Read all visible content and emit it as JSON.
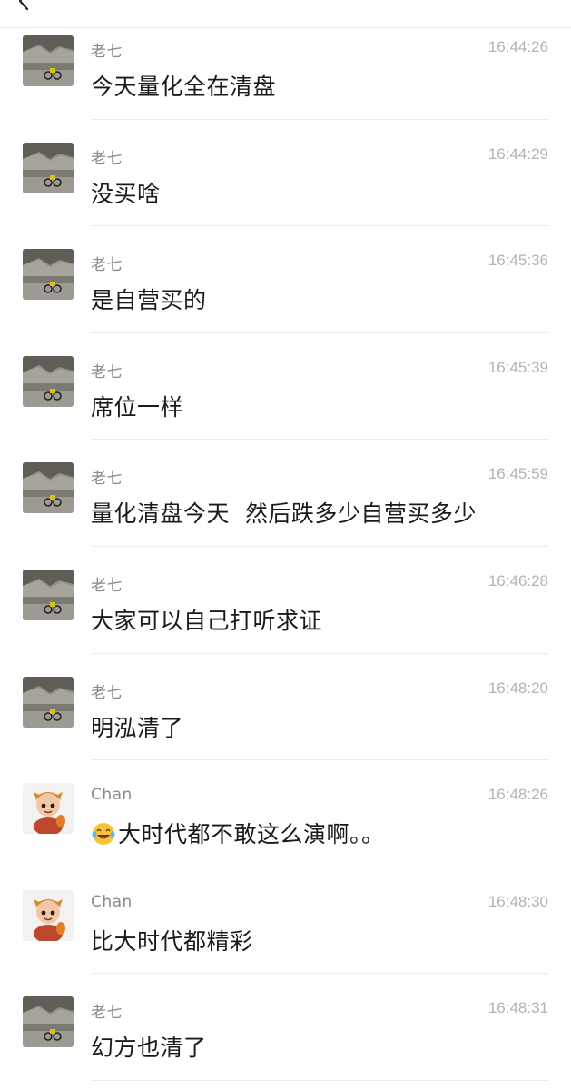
{
  "header": {
    "back_icon": "chevron-left-icon"
  },
  "messages": [
    {
      "sender": "老七",
      "time": "16:44:26",
      "text": "今天量化全在清盘",
      "avatar": "landscape-cyclist"
    },
    {
      "sender": "老七",
      "time": "16:44:29",
      "text": "没买啥",
      "avatar": "landscape-cyclist"
    },
    {
      "sender": "老七",
      "time": "16:45:36",
      "text": "是自营买的",
      "avatar": "landscape-cyclist"
    },
    {
      "sender": "老七",
      "time": "16:45:39",
      "text": "席位一样",
      "avatar": "landscape-cyclist"
    },
    {
      "sender": "老七",
      "time": "16:45:59",
      "text": "量化清盘今天  然后跌多少自营买多少",
      "avatar": "landscape-cyclist"
    },
    {
      "sender": "老七",
      "time": "16:46:28",
      "text": "大家可以自己打听求证",
      "avatar": "landscape-cyclist"
    },
    {
      "sender": "老七",
      "time": "16:48:20",
      "text": "明泓清了",
      "avatar": "landscape-cyclist"
    },
    {
      "sender": "Chan",
      "time": "16:48:26",
      "text": "大时代都不敢这么演啊。。",
      "avatar": "cartoon-character",
      "emoji": "tears-of-joy-icon"
    },
    {
      "sender": "Chan",
      "time": "16:48:30",
      "text": "比大时代都精彩",
      "avatar": "cartoon-character"
    },
    {
      "sender": "老七",
      "time": "16:48:31",
      "text": "幻方也清了",
      "avatar": "landscape-cyclist"
    }
  ],
  "colors": {
    "sender": "#8a8a8a",
    "time": "#b3b3b3",
    "text": "#1a1a1a",
    "divider": "#ececec"
  }
}
